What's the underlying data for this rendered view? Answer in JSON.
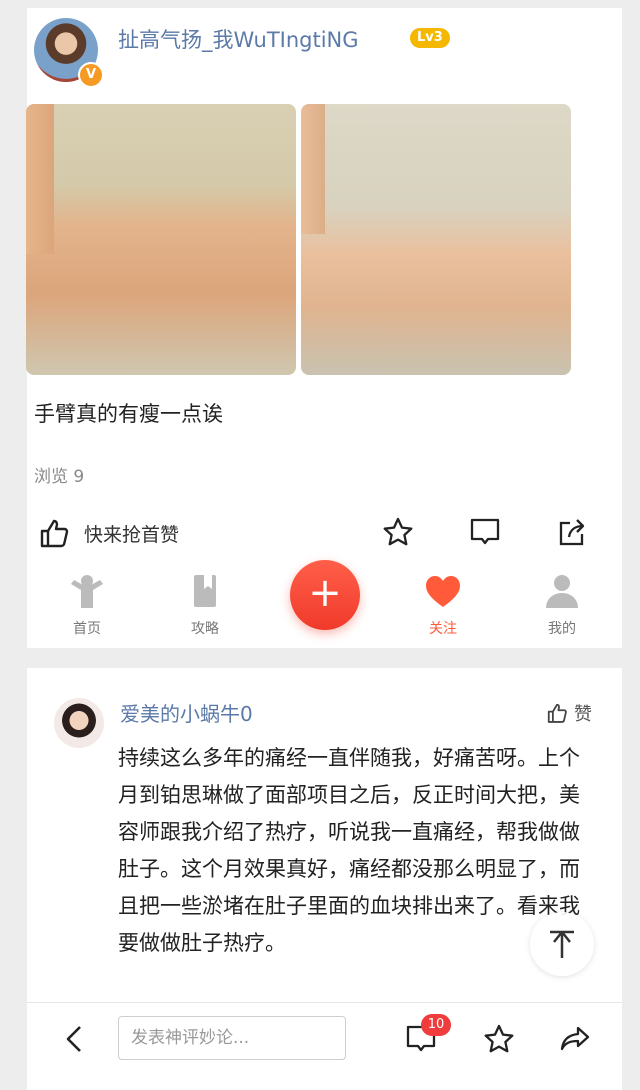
{
  "post": {
    "username": "扯高气扬_我WuTIngtiNG",
    "level": "Lv3",
    "verified_mark": "V",
    "text": "手臂真的有瘦一点诶",
    "views": "浏览 9",
    "like_prompt": "快来抢首赞"
  },
  "tabs": [
    {
      "label": "首页",
      "icon": "person-icon"
    },
    {
      "label": "攻略",
      "icon": "bookmark-icon"
    },
    {
      "label": "关注",
      "icon": "heart-icon",
      "active": true
    },
    {
      "label": "我的",
      "icon": "user-icon"
    }
  ],
  "fab_label": "+",
  "comment": {
    "author": "爱美的小蜗牛0",
    "like_label": "赞",
    "body": "持续这么多年的痛经一直伴随我，好痛苦呀。上个月到铂思琳做了面部项目之后，反正时间大把，美容师跟我介绍了热疗，听说我一直痛经，帮我做做肚子。这个月效果真好，痛经都没那么明显了，而且把一些淤堵在肚子里面的血块排出来了。看来我要做做肚子热疗。"
  },
  "bottom_bar": {
    "input_placeholder": "发表神评妙论...",
    "comment_count": "10"
  },
  "colors": {
    "accent": "#ff5b3a",
    "link": "#5b7aa8",
    "badge": "#f03c3c",
    "level": "#f5b800"
  }
}
